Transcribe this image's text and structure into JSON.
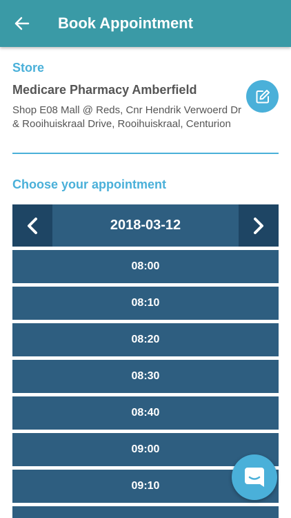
{
  "header": {
    "title": "Book Appointment",
    "back_icon": "arrow-left-icon",
    "color": "#3a9aa6"
  },
  "store": {
    "label": "Store",
    "name": "Medicare Pharmacy Amberfield",
    "address": "Shop E08 Mall @ Reds, Cnr Hendrik Verwoerd Dr & Rooihuiskraal Drive, Rooihuiskraal, Centurion",
    "edit_icon": "edit-icon"
  },
  "appointment": {
    "label": "Choose your appointment",
    "date": "2018-03-12",
    "prev_icon": "chevron-left-icon",
    "next_icon": "chevron-right-icon",
    "slots": [
      "08:00",
      "08:10",
      "08:20",
      "08:30",
      "08:40",
      "09:00",
      "09:10"
    ]
  },
  "chat": {
    "icon": "chat-icon"
  },
  "colors": {
    "accent": "#4ab0d9",
    "slot": "#2e5e80",
    "nav": "#1e4564"
  }
}
